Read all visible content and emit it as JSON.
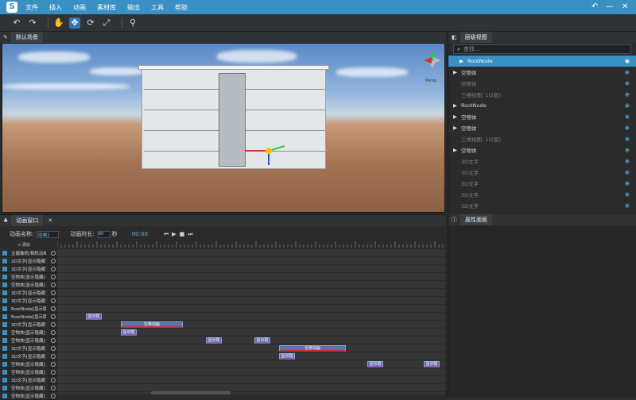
{
  "menu": {
    "items": [
      "文件",
      "插入",
      "动画",
      "素材库",
      "输出",
      "工具",
      "帮助"
    ]
  },
  "toolbar": {
    "icons": [
      "undo-icon",
      "redo-icon",
      "hand-icon",
      "move-icon",
      "rotate-icon",
      "scale-icon",
      "pin-icon"
    ]
  },
  "scene": {
    "tab": "默认场景",
    "view_label": "Persp"
  },
  "hierarchy": {
    "tab": "层级视图",
    "search_placeholder": "查找...",
    "items": [
      {
        "label": "RootNode",
        "selected": true,
        "arrow": "▶",
        "dim": false
      },
      {
        "label": "空物体",
        "arrow": "▶",
        "dim": false
      },
      {
        "label": "空物体",
        "arrow": "",
        "dim": true
      },
      {
        "label": "三维视图: 1(2层)",
        "arrow": "",
        "dim": true
      },
      {
        "label": "RootNode",
        "arrow": "▶",
        "dim": false
      },
      {
        "label": "空物体",
        "arrow": "▶",
        "dim": false
      },
      {
        "label": "空物体",
        "arrow": "▶",
        "dim": false
      },
      {
        "label": "三维视图: 1(2层)",
        "arrow": "",
        "dim": true
      },
      {
        "label": "空物体",
        "arrow": "▶",
        "dim": false
      },
      {
        "label": "3D文字",
        "arrow": "",
        "dim": true
      },
      {
        "label": "3D文字",
        "arrow": "",
        "dim": true
      },
      {
        "label": "3D文字",
        "arrow": "",
        "dim": true
      },
      {
        "label": "3D文字",
        "arrow": "",
        "dim": true
      },
      {
        "label": "3D文字",
        "arrow": "",
        "dim": true
      }
    ]
  },
  "props": {
    "tab": "属性面板"
  },
  "anim": {
    "tab": "动画窗口",
    "name_label": "动画名称:",
    "name_value": "动画1",
    "duration_label": "动画时长:",
    "duration_value": "60",
    "duration_unit": "秒",
    "time": "00:00",
    "add_label": "添加",
    "tracks": [
      "主摄像机/相机动画",
      "2D文字[显示隐藏]",
      "3D文字[显示隐藏]",
      "空物体[显示隐藏]",
      "空物体[显示隐藏]",
      "3D文字[显示隐藏]",
      "3D文字[显示隐藏]",
      "RootNode[显示隐藏]",
      "RootNode[显示隐藏]",
      "3D文字[显示隐藏]",
      "空物体[显示隐藏]",
      "空物体[显示隐藏]",
      "3D文字[显示隐藏]",
      "3D文字[显示隐藏]",
      "空物体[显示隐藏]",
      "空物体[显示隐藏]",
      "3D文字[显示隐藏]",
      "空物体[显示隐藏]",
      "空物体[显示隐藏]"
    ],
    "clips": [
      {
        "row": 8,
        "label": "显示隐"
      },
      {
        "row": 9,
        "label": "位移动画"
      },
      {
        "row": 10,
        "label": "显示隐"
      },
      {
        "row": 11,
        "label": "显示隐"
      },
      {
        "row": 11,
        "label": "显示隐"
      },
      {
        "row": 12,
        "label": "位移动画"
      },
      {
        "row": 13,
        "label": "显示隐"
      },
      {
        "row": 14,
        "label": "显示隐"
      },
      {
        "row": 14,
        "label": "显示隐"
      }
    ]
  }
}
